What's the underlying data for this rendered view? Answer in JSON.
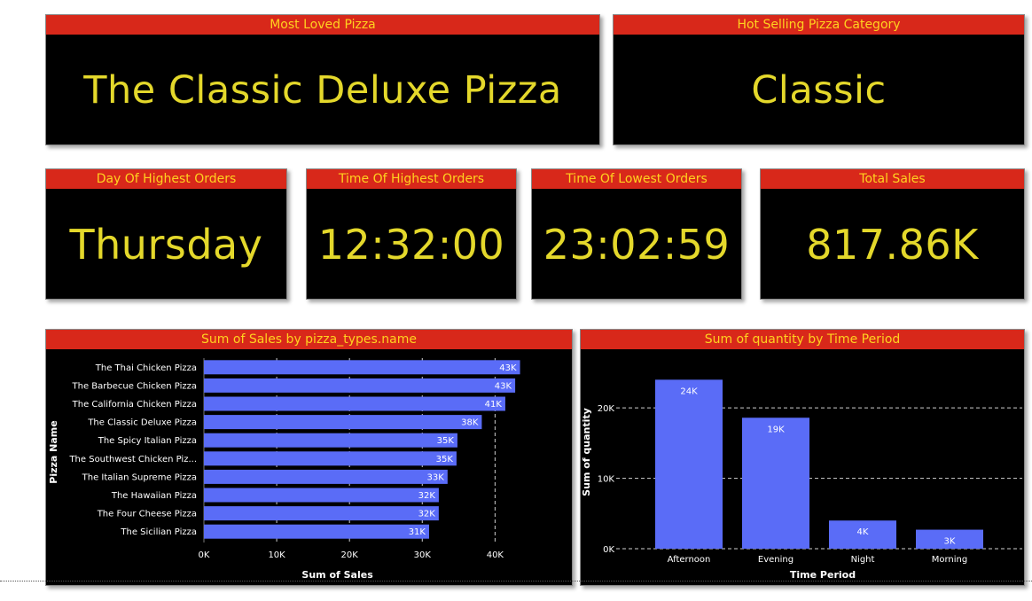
{
  "kpis": {
    "most_loved": {
      "title": "Most Loved Pizza",
      "value": "The Classic Deluxe Pizza"
    },
    "hot_category": {
      "title": "Hot Selling Pizza Category",
      "value": "Classic"
    },
    "day_highest": {
      "title": "Day Of Highest Orders",
      "value": "Thursday"
    },
    "time_highest": {
      "title": "Time Of Highest Orders",
      "value": "12:32:00"
    },
    "time_lowest": {
      "title": "Time Of Lowest Orders",
      "value": "23:02:59"
    },
    "total_sales": {
      "title": "Total Sales",
      "value": "817.86K"
    }
  },
  "colors": {
    "header_bg": "#d8281a",
    "header_text": "#ffd21f",
    "value_text": "#e4d82b",
    "bar": "#5a6cf7",
    "card_bg": "#000000"
  },
  "chart_data": [
    {
      "type": "bar",
      "orientation": "horizontal",
      "title": "Sum of Sales by pizza_types.name",
      "xlabel": "Sum of Sales",
      "ylabel": "Pizza Name",
      "categories": [
        "The Thai Chicken Pizza",
        "The Barbecue Chicken Pizza",
        "The California Chicken Pizza",
        "The Classic Deluxe Pizza",
        "The Spicy Italian Pizza",
        "The Southwest Chicken Piz...",
        "The Italian Supreme Pizza",
        "The Hawaiian Pizza",
        "The Four Cheese Pizza",
        "The Sicilian Pizza"
      ],
      "values": [
        43434,
        42768,
        41410,
        38180,
        34831,
        34706,
        33477,
        32273,
        32266,
        30940
      ],
      "data_labels": [
        "43K",
        "43K",
        "41K",
        "38K",
        "35K",
        "35K",
        "33K",
        "32K",
        "32K",
        "31K"
      ],
      "xticks": [
        "0K",
        "10K",
        "20K",
        "30K",
        "40K"
      ],
      "xlim": [
        0,
        44000
      ],
      "grid": "vertical dashed"
    },
    {
      "type": "bar",
      "orientation": "vertical",
      "title": "Sum of quantity by Time Period",
      "xlabel": "Time Period",
      "ylabel": "Sum of quantity",
      "categories": [
        "Afternoon",
        "Evening",
        "Night",
        "Morning"
      ],
      "values": [
        24000,
        18600,
        4000,
        2700
      ],
      "data_labels": [
        "24K",
        "19K",
        "4K",
        "3K"
      ],
      "yticks": [
        "0K",
        "10K",
        "20K"
      ],
      "ylim": [
        0,
        24800
      ],
      "grid": "horizontal dashed"
    }
  ]
}
